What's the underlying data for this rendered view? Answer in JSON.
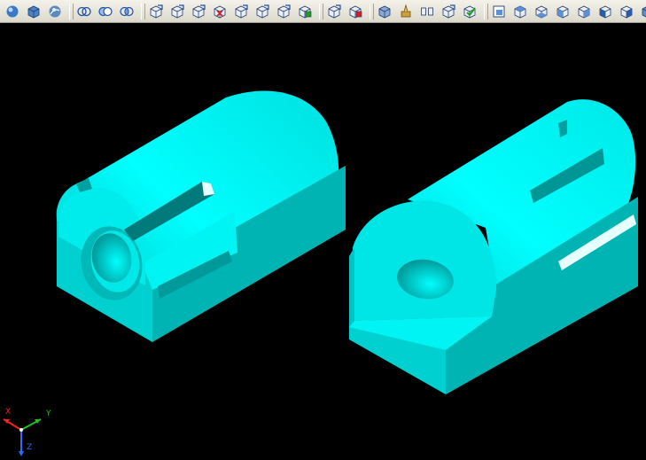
{
  "colors": {
    "model_light": "#00ffff",
    "model_mid": "#00d6d6",
    "model_dark": "#00aaaa",
    "model_shadow": "#007f7f",
    "axis_x": "#ff2020",
    "axis_y": "#20c020",
    "axis_z": "#2a6cff",
    "toolbar_bg": "#ece9d8"
  },
  "toolbar": {
    "groups": [
      {
        "name": "shade",
        "icons": [
          "sphere-shade-icon",
          "box-shade-icon",
          "globe-render-icon"
        ]
      },
      {
        "name": "boolean",
        "icons": [
          "union-icon",
          "subtract-icon",
          "intersect-icon"
        ]
      },
      {
        "name": "solid-edit",
        "icons": [
          "extrude-faces-icon",
          "move-faces-icon",
          "offset-faces-icon",
          "delete-faces-icon",
          "rotate-faces-icon",
          "taper-faces-icon",
          "copy-faces-icon",
          "color-faces-icon"
        ]
      },
      {
        "name": "edges",
        "icons": [
          "copy-edges-icon",
          "color-edges-icon"
        ]
      },
      {
        "name": "body",
        "icons": [
          "imprint-icon",
          "clean-icon",
          "separate-icon",
          "shell-icon",
          "check-icon"
        ]
      },
      {
        "name": "views",
        "icons": [
          "named-views-icon",
          "top-view-icon",
          "bottom-view-icon",
          "left-view-icon",
          "right-view-icon",
          "front-view-icon",
          "back-view-icon",
          "iso-view-icon"
        ]
      }
    ]
  },
  "ucs": {
    "x_label": "X",
    "y_label": "Y",
    "z_label": "Z"
  }
}
